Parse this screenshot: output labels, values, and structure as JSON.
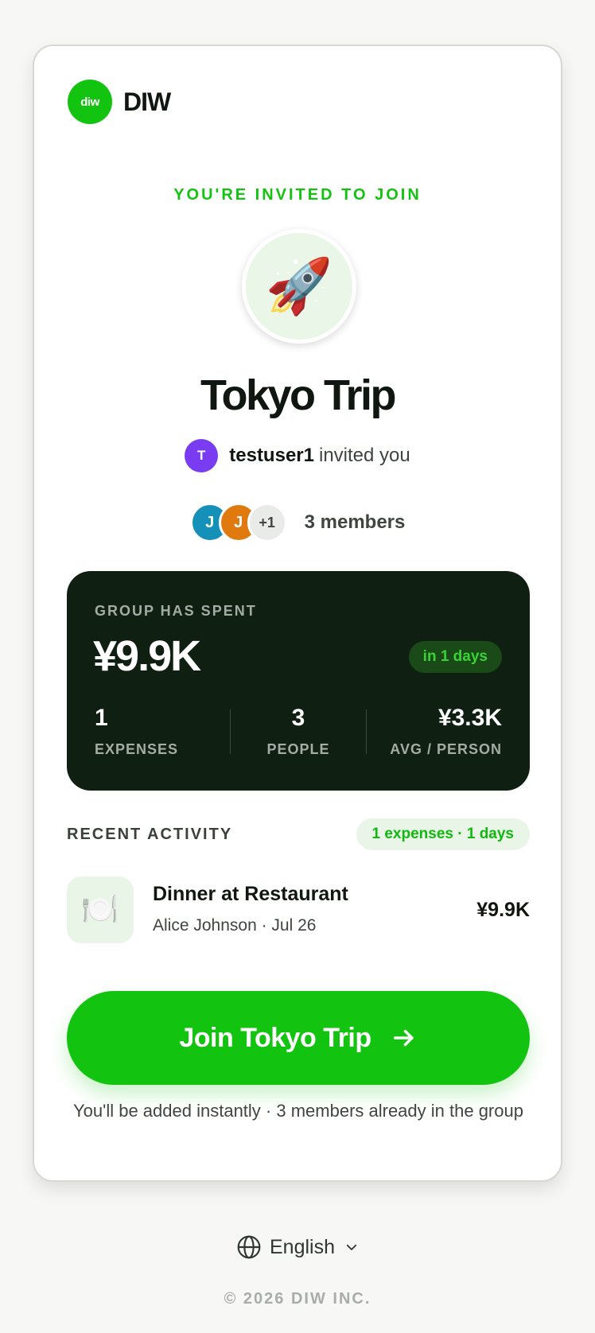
{
  "brand": {
    "logo_text": "diw",
    "name": "DIW"
  },
  "invite": {
    "label": "YOU'RE INVITED TO JOIN",
    "group_emoji": "🚀",
    "group_name": "Tokyo Trip",
    "inviter_initial": "T",
    "inviter_name": "testuser1",
    "inviter_suffix": "invited you"
  },
  "members": {
    "avatars": [
      {
        "initial": "J",
        "color": "#1590b8"
      },
      {
        "initial": "J",
        "color": "#e07a0e"
      }
    ],
    "more": "+1",
    "count_label": "3 members"
  },
  "stats": {
    "label": "GROUP HAS SPENT",
    "total": "¥9.9K",
    "period_pill": "in 1 days",
    "expenses_value": "1",
    "expenses_label": "EXPENSES",
    "people_value": "3",
    "people_label": "PEOPLE",
    "avg_value": "¥3.3K",
    "avg_label": "AVG / PERSON"
  },
  "recent": {
    "label": "RECENT ACTIVITY",
    "summary_pill": "1 expenses · 1 days",
    "items": [
      {
        "icon": "🍽️",
        "title": "Dinner at Restaurant",
        "subtitle": "Alice Johnson · Jul 26",
        "amount": "¥9.9K"
      }
    ]
  },
  "cta": {
    "join_label": "Join Tokyo Trip",
    "note": "You'll be added instantly · 3 members already in the group"
  },
  "footer": {
    "language": "English",
    "copyright": "© 2026 DIW INC."
  },
  "colors": {
    "brand_green": "#12c40f",
    "stats_bg": "#0f1f12",
    "inviter_avatar": "#7a3cf0"
  }
}
